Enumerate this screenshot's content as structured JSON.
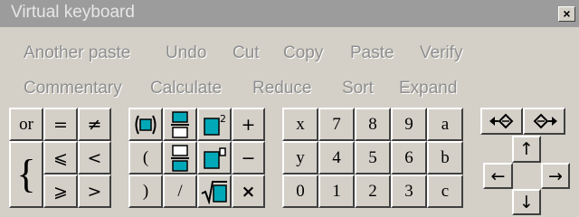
{
  "window": {
    "title": "Virtual keyboard",
    "close_label": "×"
  },
  "menu_row1": [
    "Another paste",
    "Undo",
    "Cut",
    "Copy",
    "Paste",
    "Verify"
  ],
  "menu_row2": [
    "Commentary",
    "Calculate",
    "Reduce",
    "Sort",
    "Expand"
  ],
  "logic_keys": {
    "or": "or",
    "eq": "=",
    "neq": "≠",
    "le": "⩽",
    "lt": "<",
    "ge": "⩾",
    "gt": ">",
    "brace": "{"
  },
  "math_keys": {
    "plus": "+",
    "minus": "−",
    "open_paren": "(",
    "close_paren": ")",
    "slash": "/",
    "times": "×"
  },
  "num_keys": {
    "row1": [
      "x",
      "7",
      "8",
      "9",
      "a"
    ],
    "row2": [
      "y",
      "4",
      "5",
      "6",
      "b"
    ],
    "row3": [
      "0",
      "1",
      "2",
      "3",
      "c"
    ]
  },
  "nav_keys": {
    "up": "↑",
    "left": "←",
    "right": "→",
    "down": "↓"
  },
  "icons": [
    "parenthesis-box-icon",
    "fraction-icon",
    "power-icon",
    "index-icon",
    "square-root-icon",
    "undo-view-icon",
    "redo-view-icon"
  ],
  "colors": {
    "title_bar": "#9c9c9c",
    "face": "#d4d0c8",
    "disabled_text": "#8e8e8e",
    "icon_blue": "#00a8b8"
  }
}
